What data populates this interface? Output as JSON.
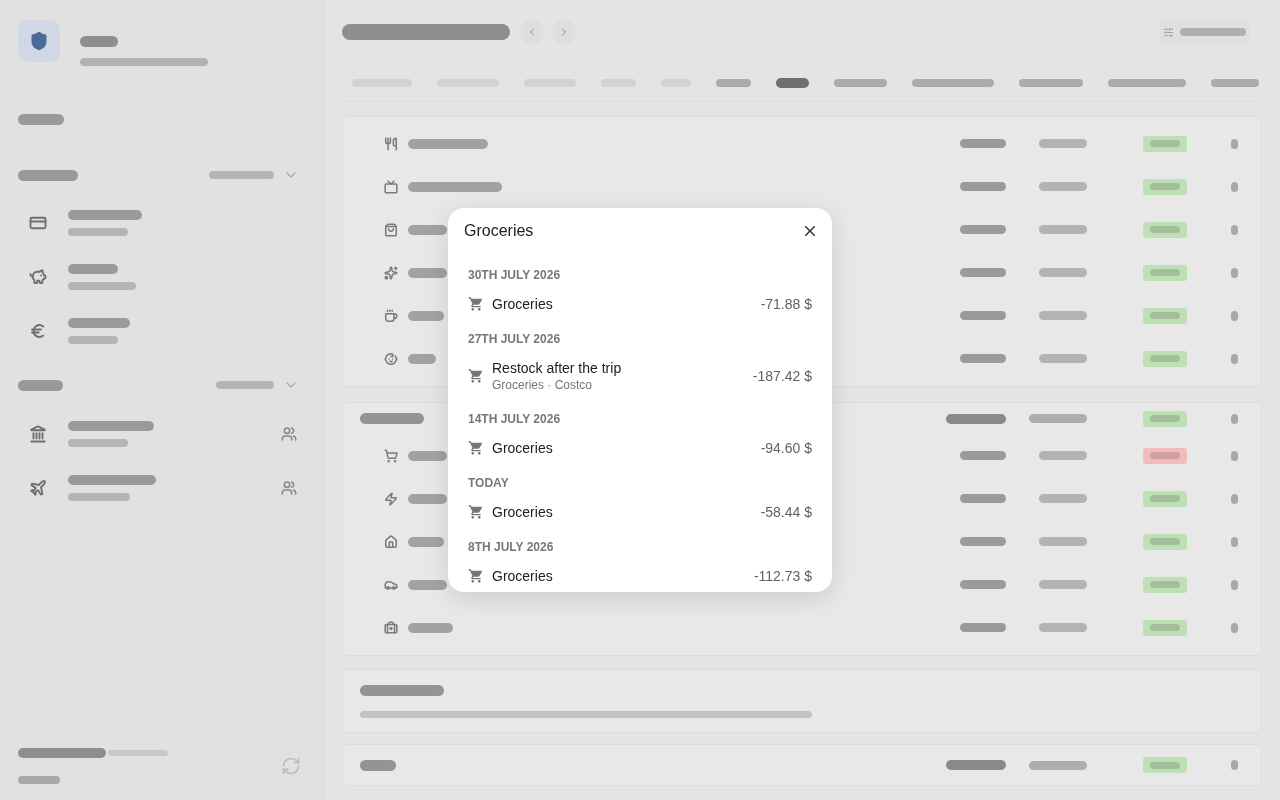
{
  "background": {
    "sidebar_groups": [
      {
        "accounts": [
          {
            "shared": false
          },
          {
            "shared": false
          },
          {
            "shared": false
          }
        ]
      },
      {
        "accounts": [
          {
            "shared": true
          },
          {
            "shared": true
          }
        ]
      }
    ],
    "month_tabs": [
      {
        "selected": false,
        "dimmed": true
      },
      {
        "selected": false,
        "dimmed": true
      },
      {
        "selected": false,
        "dimmed": true
      },
      {
        "selected": false,
        "dimmed": true
      },
      {
        "selected": false,
        "dimmed": true
      },
      {
        "selected": false,
        "dimmed": false
      },
      {
        "selected": true,
        "dimmed": false
      },
      {
        "selected": false,
        "dimmed": false
      },
      {
        "selected": false,
        "dimmed": false
      },
      {
        "selected": false,
        "dimmed": false
      },
      {
        "selected": false,
        "dimmed": false
      },
      {
        "selected": false,
        "dimmed": false
      }
    ],
    "sections": [
      {
        "rows": [
          {
            "color": "#bfe0b5"
          },
          {
            "color": "#bfe0b5"
          },
          {
            "color": "#bfe0b5"
          },
          {
            "color": "#bfe0b5"
          },
          {
            "color": "#bfe0b5"
          },
          {
            "color": "#bfe0b5"
          }
        ]
      },
      {
        "color": "#bfe0b5",
        "rows": [
          {
            "color": "#f3bcbc"
          },
          {
            "color": "#bfe0b5"
          },
          {
            "color": "#bfe0b5"
          },
          {
            "color": "#bfe0b5"
          },
          {
            "color": "#bfe0b5"
          }
        ]
      }
    ],
    "total": {
      "color": "#bfe0b5"
    }
  },
  "dialog": {
    "title": "Groceries",
    "groups": [
      {
        "date": "30TH JULY 2026",
        "entries": [
          {
            "title": "Groceries",
            "amount": "-71.88 $"
          }
        ]
      },
      {
        "date": "27TH JULY 2026",
        "entries": [
          {
            "title": "Restock after the trip",
            "subtitle": "Groceries · Costco",
            "amount": "-187.42 $"
          }
        ]
      },
      {
        "date": "14TH JULY 2026",
        "entries": [
          {
            "title": "Groceries",
            "amount": "-94.60 $"
          }
        ]
      },
      {
        "date": "TODAY",
        "entries": [
          {
            "title": "Groceries",
            "amount": "-58.44 $"
          }
        ]
      },
      {
        "date": "8TH JULY 2026",
        "entries": [
          {
            "title": "Groceries",
            "amount": "-112.73 $"
          }
        ]
      }
    ]
  }
}
